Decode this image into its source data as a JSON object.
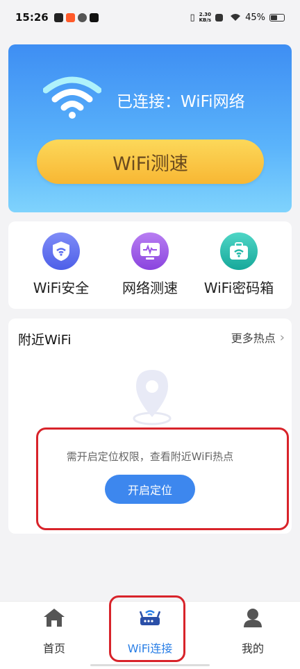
{
  "status_bar": {
    "time": "15:26",
    "net_speed_top": "2.30",
    "net_speed_bottom": "KB/s",
    "battery": "45%"
  },
  "hero": {
    "connection_status": "已连接：WiFi网络",
    "speed_test_label": "WiFi测速"
  },
  "tools": [
    {
      "label": "WiFi安全",
      "icon": "shield-wifi-icon",
      "color": "#5a6cf0"
    },
    {
      "label": "网络测速",
      "icon": "monitor-pulse-icon",
      "color": "#9b55e6"
    },
    {
      "label": "WiFi密码箱",
      "icon": "wifi-box-icon",
      "color": "#22b8a8"
    }
  ],
  "nearby": {
    "title": "附近WiFi",
    "more_label": "更多热点",
    "location_message": "需开启定位权限，查看附近WiFi热点",
    "enable_location_label": "开启定位"
  },
  "nav": [
    {
      "label": "首页",
      "icon": "home-icon",
      "active": false
    },
    {
      "label": "WiFi连接",
      "icon": "router-icon",
      "active": true
    },
    {
      "label": "我的",
      "icon": "user-icon",
      "active": false
    }
  ],
  "colors": {
    "accent_blue": "#3d87ee",
    "highlight_red": "#d8232a",
    "speed_button_yellow": "#f8b733"
  }
}
